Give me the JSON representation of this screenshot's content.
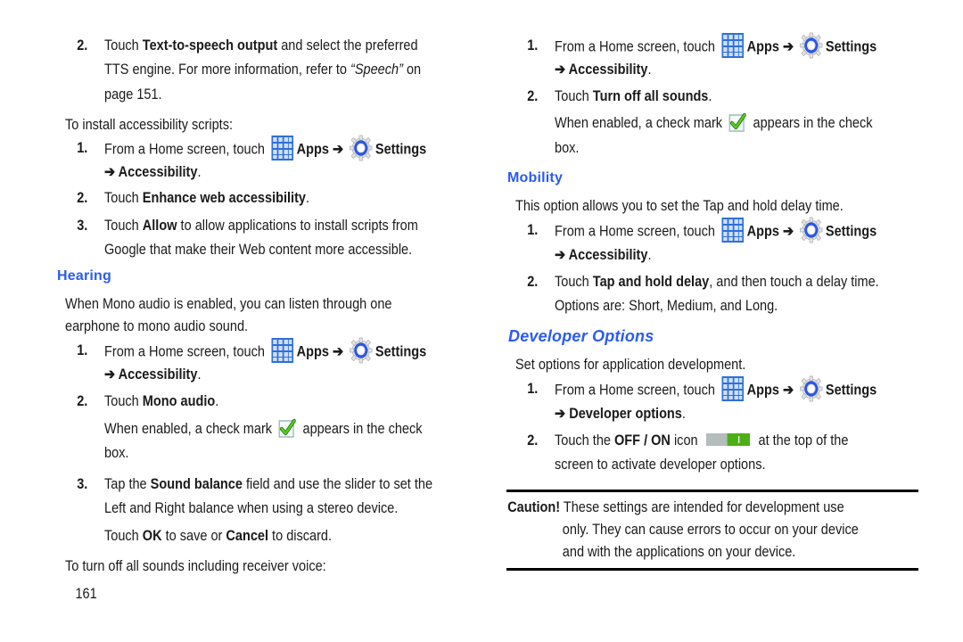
{
  "page": {
    "number": "161",
    "colors": {
      "heading": "#2a5cf0",
      "text": "#1a1a1a",
      "rule": "#000000",
      "apps_icon": "#2f6fd6",
      "gear_ring": "#2a56e6",
      "check_green": "#46c31a",
      "toggle_on": "#4caf16",
      "toggle_off": "#b4bcbc"
    }
  },
  "icons": {
    "apps": "apps-grid-icon",
    "settings": "settings-gear-icon",
    "check": "check-mark-icon",
    "toggle": "off-on-toggle-icon"
  },
  "left": {
    "tts_step": {
      "num": "2.",
      "pre": "Touch ",
      "bold": "Text-to-speech output",
      "post": " and select the preferred",
      "line2_pre": "TTS engine. For more information, refer to ",
      "line2_ital": "“Speech”",
      "line2_post": " on",
      "line3": "page 151."
    },
    "install_intro": "To install accessibility scripts:",
    "install_steps": {
      "s1": {
        "num": "1.",
        "pre": "From a Home screen, touch ",
        "apps": "Apps",
        "arrow": " ➔ ",
        "settings": "Settings",
        "line2_arrow": "➔ ",
        "line2_bold": "Accessibility",
        "line2_post": "."
      },
      "s2": {
        "num": "2.",
        "pre": "Touch ",
        "bold": "Enhance web accessibility",
        "post": "."
      },
      "s3": {
        "num": "3.",
        "pre": "Touch ",
        "bold": "Allow",
        "post": " to allow applications to install scripts from",
        "line2": "Google that make their Web content more accessible."
      }
    },
    "hearing": {
      "heading": "Hearing",
      "intro_line1": "When Mono audio is enabled, you can listen through one",
      "intro_line2": "earphone to mono audio sound.",
      "s1": {
        "num": "1.",
        "pre": "From a Home screen, touch ",
        "apps": "Apps",
        "arrow": " ➔ ",
        "settings": "Settings",
        "line2_arrow": "➔ ",
        "line2_bold": "Accessibility",
        "line2_post": "."
      },
      "s2": {
        "num": "2.",
        "pre": "Touch ",
        "bold": "Mono audio",
        "post": "."
      },
      "s2_note_pre": "When enabled, a check mark ",
      "s2_note_post": " appears in the check",
      "s2_note_line2": "box.",
      "s3": {
        "num": "3.",
        "pre": "Tap the ",
        "bold": "Sound balance",
        "post": " field and use the slider to set the",
        "line2": "Left and Right balance when using a stereo device.",
        "line3_pre": "Touch ",
        "line3_b1": "OK",
        "line3_mid": " to save or ",
        "line3_b2": "Cancel",
        "line3_post": " to discard."
      },
      "turn_off_intro": "To turn off all sounds including receiver voice:"
    }
  },
  "right": {
    "sounds": {
      "s1": {
        "num": "1.",
        "pre": "From a Home screen, touch ",
        "apps": "Apps",
        "arrow": " ➔ ",
        "settings": "Settings",
        "line2_arrow": "➔ ",
        "line2_bold": "Accessibility",
        "line2_post": "."
      },
      "s2": {
        "num": "2.",
        "pre": "Touch ",
        "bold": "Turn off all sounds",
        "post": "."
      },
      "note_pre": "When enabled, a check mark ",
      "note_post": " appears in the check",
      "note_line2": "box."
    },
    "mobility": {
      "heading": "Mobility",
      "intro": "This option allows you to set the Tap and hold delay time.",
      "s1": {
        "num": "1.",
        "pre": "From a Home screen, touch ",
        "apps": "Apps",
        "arrow": " ➔ ",
        "settings": "Settings",
        "line2_arrow": "➔ ",
        "line2_bold": "Accessibility",
        "line2_post": "."
      },
      "s2": {
        "num": "2.",
        "pre": "Touch ",
        "bold": "Tap and hold delay",
        "post": ", and then touch a delay time.",
        "line2": "Options are: Short, Medium, and Long."
      }
    },
    "developer": {
      "heading": "Developer Options",
      "intro": "Set options for application development.",
      "s1": {
        "num": "1.",
        "pre": "From a Home screen, touch ",
        "apps": "Apps",
        "arrow": " ➔ ",
        "settings": "Settings",
        "line2_arrow": "➔ ",
        "line2_bold": "Developer options",
        "line2_post": "."
      },
      "s2": {
        "num": "2.",
        "pre": "Touch the ",
        "bold": "OFF / ON",
        "mid": " icon ",
        "post": " at the top of the",
        "line2": "screen to activate developer options."
      }
    },
    "caution": {
      "label": "Caution!",
      "line1": " These settings are intended for development use",
      "line2": "only. They can cause errors to occur on your device",
      "line3": "and with the applications on your device."
    }
  }
}
